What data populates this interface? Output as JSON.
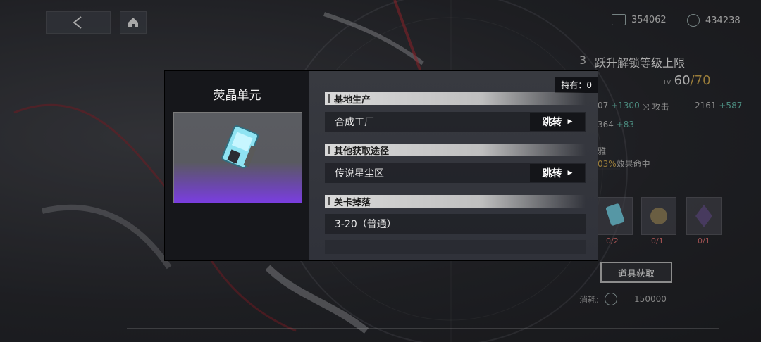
{
  "header": {
    "currency_1": "354062",
    "currency_2": "434238"
  },
  "right_panel": {
    "rank_num": "3",
    "title": "跃升解锁等级上限",
    "level_label": "LV",
    "level_current": "60",
    "level_sep": "/",
    "level_max": "70",
    "stats": {
      "left_val_a": "07",
      "left_bonus_a": "+1300",
      "attack_label": "攻击",
      "attack_val": "2161",
      "attack_bonus": "+587",
      "left_val_b": "364",
      "left_bonus_b": "+83",
      "effect_label_tail": "雅",
      "effect_pct": "03%",
      "effect_text": "效果命中"
    },
    "materials": [
      {
        "count": "0/2"
      },
      {
        "count": "0/1"
      },
      {
        "count": "0/1"
      }
    ],
    "get_items_button": "道具获取",
    "cost_label": "消耗:",
    "cost_value": "150000"
  },
  "modal": {
    "item_name": "荧晶单元",
    "hold_label": "持有：0",
    "sections": [
      {
        "title": "基地生产",
        "rows": [
          {
            "text": "合成工厂",
            "button": "跳转"
          }
        ]
      },
      {
        "title": "其他获取途径",
        "rows": [
          {
            "text": "传说星尘区",
            "button": "跳转"
          }
        ]
      },
      {
        "title": "关卡掉落",
        "rows": [
          {
            "text": "3-20（普通）"
          }
        ]
      }
    ]
  },
  "colors": {
    "accent_green": "#5fb3a3",
    "level_max_gold": "#c9a24a",
    "missing_red": "#d46a6a",
    "rarity_purple": "#7a3ee0"
  }
}
